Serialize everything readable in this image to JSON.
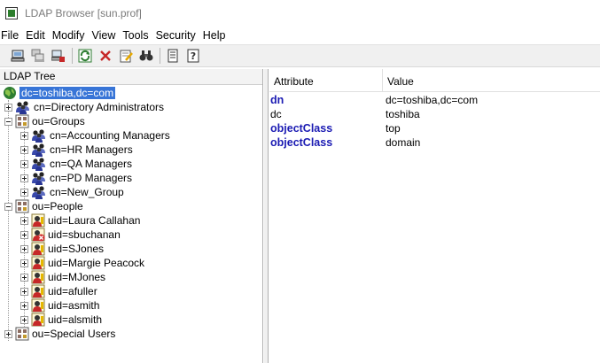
{
  "window": {
    "title": "LDAP Browser [sun.prof]"
  },
  "menu": [
    "File",
    "Edit",
    "Modify",
    "View",
    "Tools",
    "Security",
    "Help"
  ],
  "toolbar": {
    "buttons": [
      "connect-icon",
      "copy-connection-icon",
      "disconnect-icon",
      "refresh-icon",
      "delete-icon",
      "edit-icon",
      "search-binoculars-icon",
      "properties-icon",
      "help-icon"
    ]
  },
  "tree": {
    "header": "LDAP Tree",
    "nodes": [
      {
        "label": "dc=toshiba,dc=com",
        "icon": "globe-icon",
        "level": 0,
        "expander": "none",
        "selected": true
      },
      {
        "label": "cn=Directory Administrators",
        "icon": "group-icon",
        "level": 1,
        "expander": "plus"
      },
      {
        "label": "ou=Groups",
        "icon": "org-unit-icon",
        "level": 1,
        "expander": "minus"
      },
      {
        "label": "cn=Accounting Managers",
        "icon": "group-icon",
        "level": 2,
        "expander": "plus"
      },
      {
        "label": "cn=HR Managers",
        "icon": "group-icon",
        "level": 2,
        "expander": "plus"
      },
      {
        "label": "cn=QA Managers",
        "icon": "group-icon",
        "level": 2,
        "expander": "plus"
      },
      {
        "label": "cn=PD Managers",
        "icon": "group-icon",
        "level": 2,
        "expander": "plus"
      },
      {
        "label": "cn=New_Group",
        "icon": "group-icon",
        "level": 2,
        "expander": "plus"
      },
      {
        "label": "ou=People",
        "icon": "org-unit-icon",
        "level": 1,
        "expander": "minus"
      },
      {
        "label": "uid=Laura Callahan",
        "icon": "user-icon",
        "level": 2,
        "expander": "plus"
      },
      {
        "label": "uid=sbuchanan",
        "icon": "user-disabled-icon",
        "level": 2,
        "expander": "plus"
      },
      {
        "label": "uid=SJones",
        "icon": "user-icon",
        "level": 2,
        "expander": "plus"
      },
      {
        "label": "uid=Margie Peacock",
        "icon": "user-icon",
        "level": 2,
        "expander": "plus"
      },
      {
        "label": "uid=MJones",
        "icon": "user-icon",
        "level": 2,
        "expander": "plus"
      },
      {
        "label": "uid=afuller",
        "icon": "user-icon",
        "level": 2,
        "expander": "plus"
      },
      {
        "label": "uid=asmith",
        "icon": "user-icon",
        "level": 2,
        "expander": "plus"
      },
      {
        "label": "uid=alsmith",
        "icon": "user-icon",
        "level": 2,
        "expander": "plus"
      },
      {
        "label": "ou=Special Users",
        "icon": "org-unit-icon",
        "level": 1,
        "expander": "plus"
      }
    ]
  },
  "attributes": {
    "headers": {
      "attribute": "Attribute",
      "value": "Value"
    },
    "rows": [
      {
        "name": "dn",
        "value": "dc=toshiba,dc=com",
        "bold": true
      },
      {
        "name": "dc",
        "value": "toshiba",
        "bold": false
      },
      {
        "name": "objectClass",
        "value": "top",
        "bold": true
      },
      {
        "name": "objectClass",
        "value": "domain",
        "bold": true
      }
    ]
  },
  "colors": {
    "selection": "#3875d7",
    "attribute_bold": "#1b1bb3"
  }
}
